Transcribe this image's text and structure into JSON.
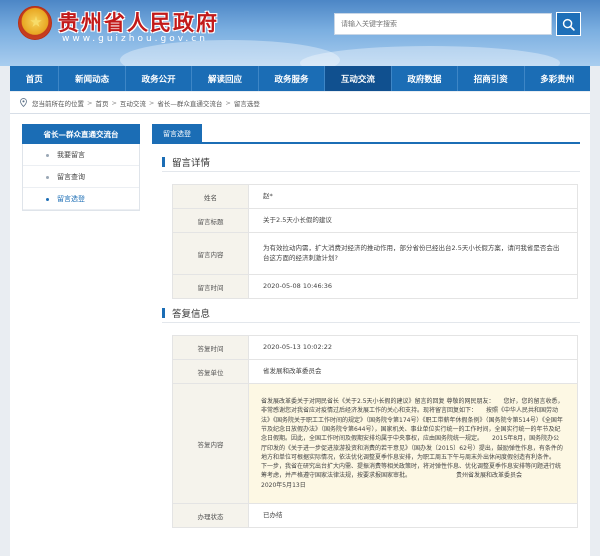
{
  "header": {
    "site_title": "贵州省人民政府",
    "site_domain": "www.guizhou.gov.cn",
    "search_placeholder": "请输入关键字搜索"
  },
  "nav": [
    {
      "label": "首页"
    },
    {
      "label": "新闻动态"
    },
    {
      "label": "政务公开"
    },
    {
      "label": "解读回应"
    },
    {
      "label": "政务服务"
    },
    {
      "label": "互动交流",
      "active": true
    },
    {
      "label": "政府数据"
    },
    {
      "label": "招商引资"
    },
    {
      "label": "多彩贵州"
    }
  ],
  "breadcrumb": {
    "prefix": "您当前所在的位置",
    "items": [
      "首页",
      "互动交流",
      "省长—群众直通交流台",
      "留言选登"
    ]
  },
  "sidebar": {
    "title": "省长—群众直通交流台",
    "items": [
      {
        "label": "我要留言"
      },
      {
        "label": "留言查询"
      },
      {
        "label": "留言选登",
        "active": true
      }
    ]
  },
  "tab": {
    "label": "留言选登"
  },
  "message_section": {
    "title": "留言详情",
    "rows": [
      {
        "label": "姓名",
        "value": "赵*"
      },
      {
        "label": "留言标题",
        "value": "关于2.5天小长假的建议"
      },
      {
        "label": "留言内容",
        "value": "为有效拉动内需，扩大消费对经济的推动作用，部分省份已经出台2.5天小长假方案，请问我省是否会出台这方面的经济刺激计划?"
      },
      {
        "label": "留言时间",
        "value": "2020-05-08 10:46:36"
      }
    ]
  },
  "reply_section": {
    "title": "答复信息",
    "rows": [
      {
        "label": "答复时间",
        "value": "2020-05-13 10:02:22"
      },
      {
        "label": "答复单位",
        "value": "省发展和改革委员会"
      },
      {
        "label": "答复内容",
        "value": "省发展改革委关于对网民省长《关于2.5天小长假的建议》留言的回复 尊敬的网民朋友：　　您好，您的留言收悉，非常感谢您对我省应对疫情过后经济发展工作的关心和支持。现将留言回复如下：　　按照《中华人民共和国劳动法》《国务院关于职工工作时间的规定》（国务院令第174号）《职工带薪年休假条例》（国务院令第514号）《全国年节及纪念日放假办法》（国务院令第644号），国家机关、事业单位实行统一的工作时间，全国实行统一的年节及纪念日假期。因此，全国工作时间及假期安排均属于中央事权，应由国务院统一规定。　　2015年8月，国务院办公厅印发的《关于进一步促进旅游投资和消费的若干意见》（国办发〔2015〕62号）提出，鼓励弹性作息，有条件的地方和单位可根据实际情况，依法优化调整夏季作息安排，为职工周五下午与周末外出休闲度假创造有利条件。　　下一步，我省在研究出台扩大内需、提振消费等相关政策时，将对弹性作息、优化调整夏季作息安排等问题进行统筹考虑，并严格遵守国家法律法规，按要求报国家审批。　　　　　　　　贵州省发展和改革委员会　　　　　　2020年5月13日"
      },
      {
        "label": "办理状态",
        "value": "已办结"
      }
    ]
  },
  "colors": {
    "brand_blue": "#1b6db5",
    "title_red": "#c21a1a"
  }
}
